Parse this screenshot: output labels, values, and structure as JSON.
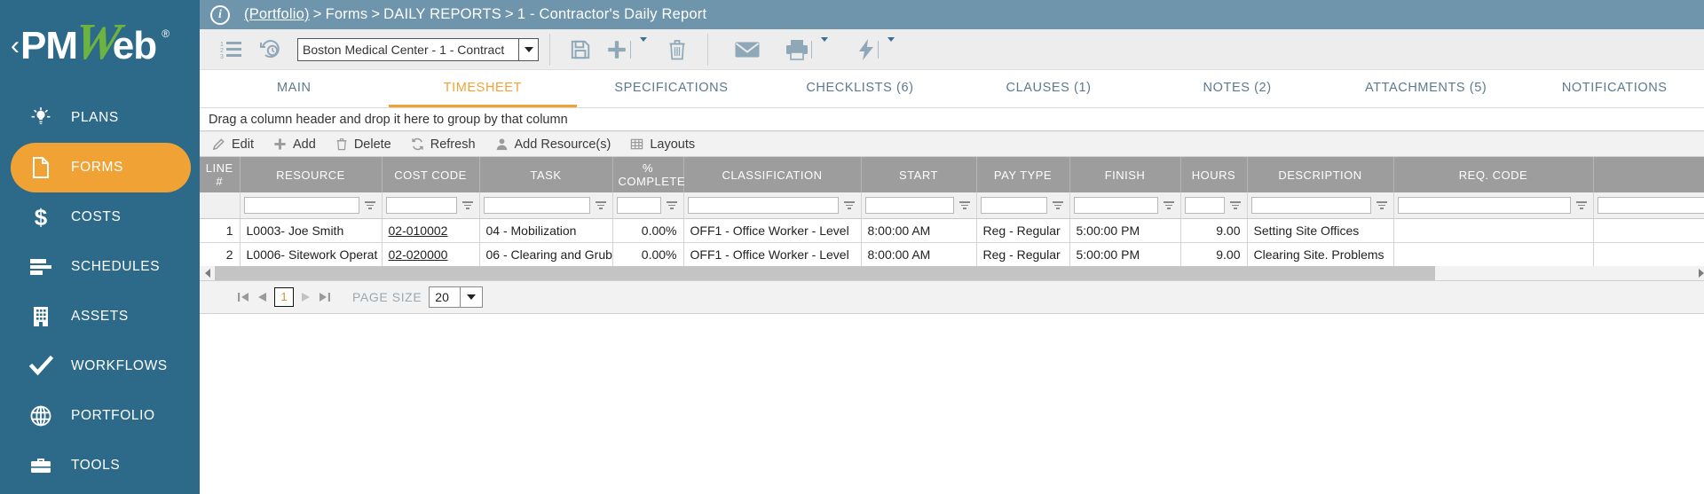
{
  "sidebar": {
    "logo": {
      "chevron": "‹",
      "left": "PM",
      "w": "W",
      "right": "eb",
      "reg": "®"
    },
    "items": [
      {
        "label": "PLANS",
        "icon": "lightbulb-icon",
        "active": false
      },
      {
        "label": "FORMS",
        "icon": "document-icon",
        "active": true
      },
      {
        "label": "COSTS",
        "icon": "dollar-icon",
        "active": false
      },
      {
        "label": "SCHEDULES",
        "icon": "gantt-icon",
        "active": false
      },
      {
        "label": "ASSETS",
        "icon": "building-icon",
        "active": false
      },
      {
        "label": "WORKFLOWS",
        "icon": "check-icon",
        "active": false
      },
      {
        "label": "PORTFOLIO",
        "icon": "globe-icon",
        "active": false
      },
      {
        "label": "TOOLS",
        "icon": "briefcase-icon",
        "active": false
      }
    ]
  },
  "breadcrumb": {
    "info_icon": "info-icon",
    "root": "(Portfolio)",
    "sep": ">",
    "level2": "Forms",
    "level3": "DAILY REPORTS",
    "level4": "1 - Contractor's Daily Report"
  },
  "toolbar": {
    "list_icon": "numbered-list-icon",
    "history_icon": "history-icon",
    "project": {
      "value": "Boston Medical Center - 1 - Contract",
      "icon": "chevron-down-icon"
    },
    "save_icon": "save-floppy-icon",
    "add_icon": "plus-icon",
    "delete_icon": "trash-icon",
    "email_icon": "envelope-icon",
    "print_icon": "printer-icon",
    "workflow_icon": "lightning-icon"
  },
  "tabs": [
    {
      "label": "MAIN",
      "active": false
    },
    {
      "label": "TIMESHEET",
      "active": true
    },
    {
      "label": "SPECIFICATIONS",
      "active": false
    },
    {
      "label": "CHECKLISTS (6)",
      "active": false
    },
    {
      "label": "CLAUSES (1)",
      "active": false
    },
    {
      "label": "NOTES (2)",
      "active": false
    },
    {
      "label": "ATTACHMENTS (5)",
      "active": false
    },
    {
      "label": "NOTIFICATIONS",
      "active": false
    }
  ],
  "grid": {
    "group_hint": "Drag a column header and drop it here to group by that column",
    "actions": [
      {
        "label": "Edit",
        "icon": "pencil-icon"
      },
      {
        "label": "Add",
        "icon": "plus-icon"
      },
      {
        "label": "Delete",
        "icon": "trash-icon"
      },
      {
        "label": "Refresh",
        "icon": "refresh-icon"
      },
      {
        "label": "Add Resource(s)",
        "icon": "person-icon"
      },
      {
        "label": "Layouts",
        "icon": "grid-icon"
      }
    ],
    "columns": [
      "LINE #",
      "RESOURCE",
      "COST CODE",
      "TASK",
      "% COMPLETE",
      "CLASSIFICATION",
      "START",
      "PAY TYPE",
      "FINISH",
      "HOURS",
      "DESCRIPTION",
      "REQ. CODE",
      ""
    ],
    "rows": [
      {
        "line": "1",
        "resource": "L0003- Joe Smith",
        "cost_code": "02-010002",
        "task": "04 - Mobilization",
        "percent_complete": "0.00%",
        "classification": "OFF1 - Office Worker - Level",
        "start": "8:00:00 AM",
        "pay_type": "Reg - Regular",
        "finish": "5:00:00 PM",
        "hours": "9.00",
        "description": "Setting Site Offices",
        "req_code": "",
        "extra": ""
      },
      {
        "line": "2",
        "resource": "L0006- Sitework Operat",
        "cost_code": "02-020000",
        "task": "06 - Clearing and Grubb",
        "percent_complete": "0.00%",
        "classification": "OFF1 - Office Worker - Level",
        "start": "8:00:00 AM",
        "pay_type": "Reg - Regular",
        "finish": "5:00:00 PM",
        "hours": "9.00",
        "description": "Clearing Site. Problems",
        "req_code": "",
        "extra": ""
      }
    ],
    "pager": {
      "first_icon": "first-page-icon",
      "prev_icon": "prev-page-icon",
      "page": "1",
      "next_icon": "next-page-icon",
      "last_icon": "last-page-icon",
      "page_size_label": "PAGE SIZE",
      "page_size_value": "20",
      "page_size_icon": "chevron-down-icon"
    }
  },
  "colors": {
    "sidebar": "#2d6a8a",
    "accent": "#f0a334",
    "breadcrumb": "#6e95ab",
    "header": "#9d9d9d",
    "logo_green": "#6cb33f"
  }
}
